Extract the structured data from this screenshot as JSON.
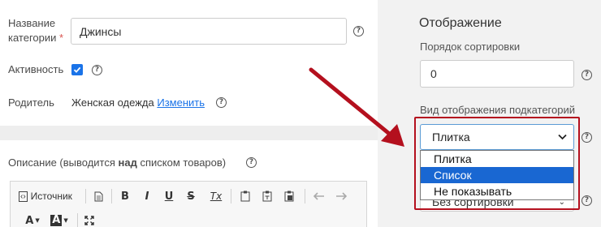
{
  "category_form": {
    "name_label_line1": "Название",
    "name_label_line2": "категории",
    "required_mark": "*",
    "name_value": "Джинсы",
    "active_label": "Активность",
    "active_checked": true,
    "parent_label": "Родитель",
    "parent_value": "Женская одежда",
    "parent_change_link": "Изменить"
  },
  "description": {
    "label_prefix": "Описание (выводится ",
    "label_bold": "над",
    "label_suffix": " списком товаров)"
  },
  "editor_toolbar": {
    "source_label": "Источник",
    "items": [
      "source-icon",
      "document-icon",
      "bold",
      "italic",
      "underline",
      "strikethrough",
      "remove-format",
      "paste",
      "paste-text",
      "paste-word",
      "undo",
      "redo",
      "text-color",
      "background-color",
      "maximize"
    ],
    "bold_glyph": "B",
    "italic_glyph": "I",
    "underline_glyph": "U",
    "strike_glyph": "S",
    "clear_format_glyph": "Tx",
    "text_color_glyph": "A",
    "bg_color_glyph": "A"
  },
  "display_panel": {
    "title": "Отображение",
    "sort_order_label": "Порядок сортировки",
    "sort_order_value": "0",
    "subcat_view_label": "Вид отображения подкатегорий",
    "subcat_view_selected": "Плитка",
    "subcat_view_options": [
      "Плитка",
      "Список",
      "Не показывать"
    ],
    "highlighted_option_index": 1,
    "sorting_select_value": "Без сортировки"
  },
  "colors": {
    "accent": "#1a73e8",
    "highlight_option": "#1967d2",
    "annotation_red": "#b4101e",
    "right_panel_bg": "#f2f2f2"
  }
}
